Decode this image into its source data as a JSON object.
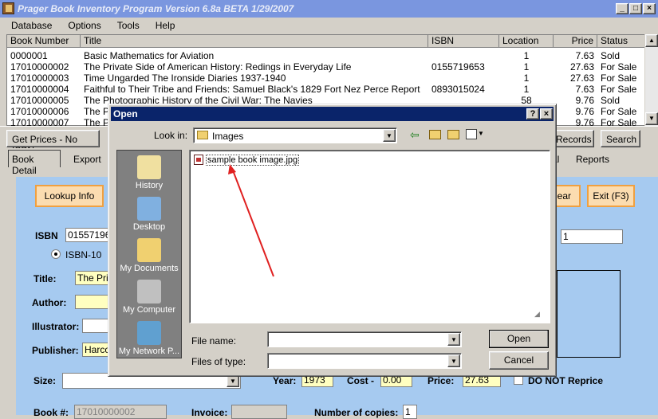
{
  "window": {
    "title": "Prager Book Inventory Program   Version 6.8a BETA  1/29/2007",
    "minimize": "_",
    "maximize": "□",
    "close": "×"
  },
  "menu": [
    "Database",
    "Options",
    "Tools",
    "Help"
  ],
  "grid": {
    "headers": [
      "Book Number",
      "Title",
      "ISBN",
      "Location",
      "Price",
      "Status"
    ],
    "rows": [
      {
        "num": "0000001",
        "title": "Basic Mathematics for Aviation",
        "isbn": "",
        "loc": "1",
        "price": "7.63",
        "status": "Sold"
      },
      {
        "num": "17010000002",
        "title": "The Private Side of American History: Redings in Everyday Life",
        "isbn": "0155719653",
        "loc": "1",
        "price": "27.63",
        "status": "For Sale"
      },
      {
        "num": "17010000003",
        "title": "Time Ungarded The Ironside Diaries 1937-1940",
        "isbn": "",
        "loc": "1",
        "price": "27.63",
        "status": "For Sale"
      },
      {
        "num": "17010000004",
        "title": "Faithful to Their Tribe and Friends: Samuel Black's 1829 Fort Nez Perce Report",
        "isbn": "0893015024",
        "loc": "1",
        "price": "7.63",
        "status": "For Sale"
      },
      {
        "num": "17010000005",
        "title": "The Photographic History of the Civil War: The Navies",
        "isbn": "",
        "loc": "58",
        "price": "9.76",
        "status": "Sold"
      },
      {
        "num": "17010000006",
        "title": "The P",
        "isbn": "",
        "loc": "",
        "price": "9.76",
        "status": "For Sale"
      },
      {
        "num": "17010000007",
        "title": "The P",
        "isbn": "",
        "loc": "",
        "price": "9.76",
        "status": "For Sale"
      }
    ]
  },
  "tabs_top": {
    "left": "Get Prices - No ISBN",
    "records": "Records",
    "search": "Search"
  },
  "tabs_second": {
    "book_detail": "Book Detail",
    "export": "Export",
    "reports": "Reports",
    "partial": "al"
  },
  "buttons": {
    "lookup": "Lookup Info",
    "clear": "lear",
    "exit": "Exit (F3)"
  },
  "form": {
    "isbn_label": "ISBN",
    "isbn_value": "0155719653",
    "isbn10": "ISBN-10",
    "title_label": "Title:",
    "title_value": "The Priv",
    "author_label": "Author:",
    "illustrator_label": "Illustrator:",
    "publisher_label": "Publisher:",
    "publisher_value": "Harco",
    "size_label": "Size:",
    "year_label": "Year:",
    "year_value": "1973",
    "cost_label": "Cost -",
    "cost_value": "0.00",
    "price_label": "Price:",
    "price_value": "27.63",
    "donot_reprice": "DO NOT Reprice",
    "booknum_label": "Book #:",
    "booknum_value": "17010000002",
    "invoice_label": "Invoice:",
    "copies_label": "Number of copies:",
    "copies_value": "1",
    "right_field_value": "1"
  },
  "dialog": {
    "title": "Open",
    "help": "?",
    "close": "×",
    "lookin_label": "Look in:",
    "lookin_value": "Images",
    "places": [
      "History",
      "Desktop",
      "My Documents",
      "My Computer",
      "My Network P..."
    ],
    "file": "sample book image.jpg",
    "filename_label": "File name:",
    "filename_value": "",
    "filetype_label": "Files of type:",
    "filetype_value": "",
    "open": "Open",
    "cancel": "Cancel"
  }
}
